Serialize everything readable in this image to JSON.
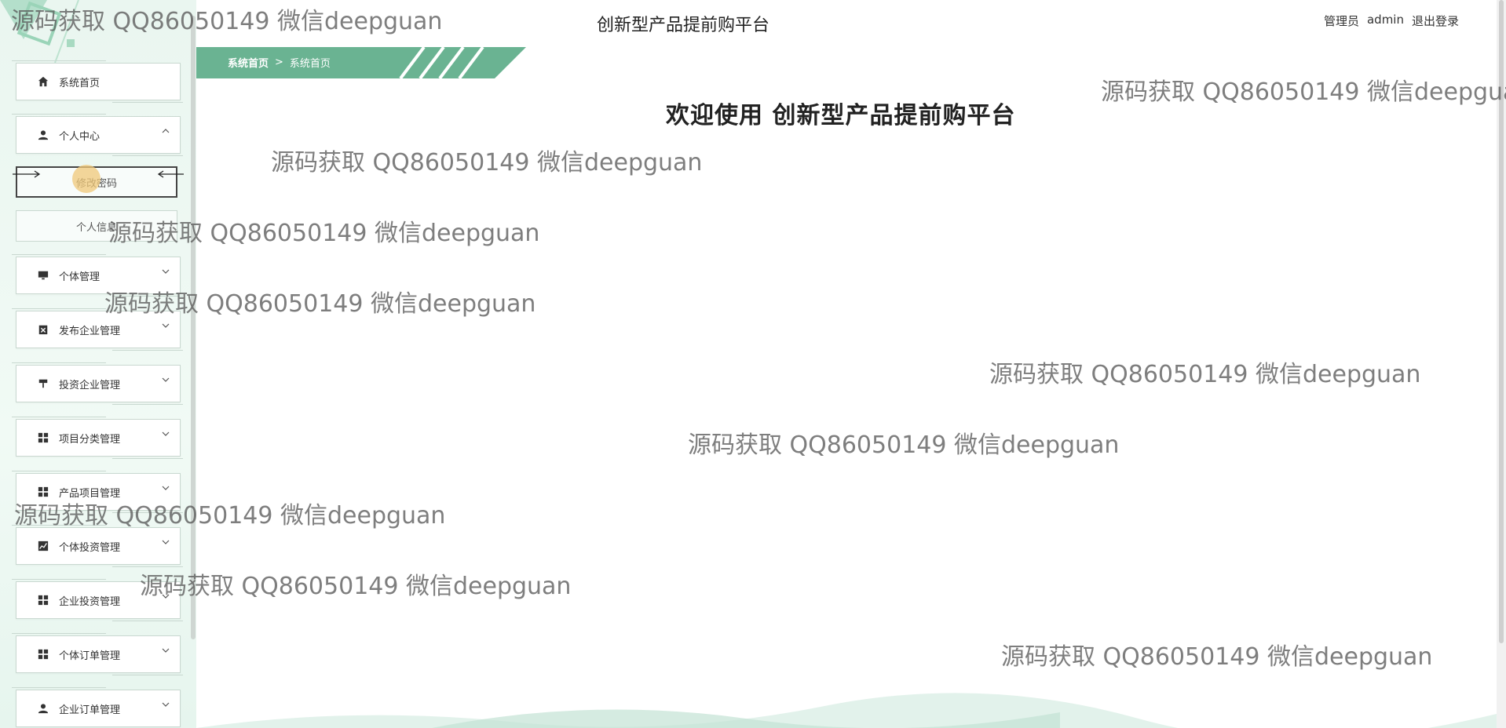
{
  "header": {
    "app_title": "创新型产品提前购平台",
    "user_role": "管理员",
    "username": "admin",
    "logout_label": "退出登录"
  },
  "breadcrumb": {
    "home": "系统首页",
    "separator": ">",
    "current": "系统首页"
  },
  "main": {
    "welcome_text": "欢迎使用 创新型产品提前购平台"
  },
  "sidebar": {
    "items": [
      {
        "label": "系统首页",
        "icon": "home-icon"
      },
      {
        "label": "个人中心",
        "icon": "user-icon",
        "expanded": true,
        "children": [
          {
            "label": "修改密码",
            "active": true
          },
          {
            "label": "个人信息"
          }
        ]
      },
      {
        "label": "个体管理",
        "icon": "monitor-icon"
      },
      {
        "label": "发布企业管理",
        "icon": "clipboard-x-icon"
      },
      {
        "label": "投资企业管理",
        "icon": "paint-roller-icon"
      },
      {
        "label": "项目分类管理",
        "icon": "grid-icon"
      },
      {
        "label": "产品项目管理",
        "icon": "grid-icon"
      },
      {
        "label": "个体投资管理",
        "icon": "chart-line-icon"
      },
      {
        "label": "企业投资管理",
        "icon": "grid-icon"
      },
      {
        "label": "个体订单管理",
        "icon": "grid-icon"
      },
      {
        "label": "企业订单管理",
        "icon": "user-icon"
      }
    ]
  },
  "watermark": {
    "text": "源码获取 QQ86050149 微信deepguan"
  },
  "colors": {
    "accent": "#6ab392",
    "sidebar_bg": "#eaf6f0"
  }
}
